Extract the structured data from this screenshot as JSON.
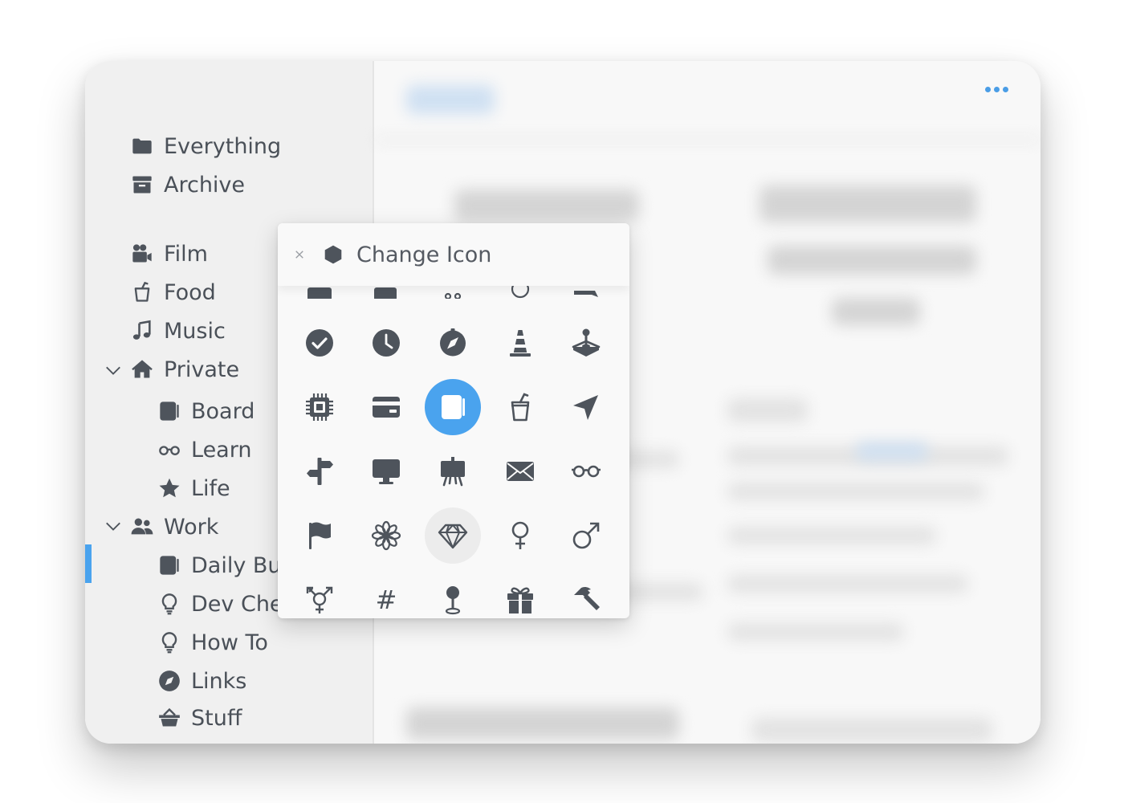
{
  "sidebar": {
    "items": [
      {
        "label": "Everything",
        "icon": "folder-icon"
      },
      {
        "label": "Archive",
        "icon": "archive-icon"
      },
      {
        "label": "Film",
        "icon": "video-camera-icon"
      },
      {
        "label": "Food",
        "icon": "cup-icon"
      },
      {
        "label": "Music",
        "icon": "music-note-icon"
      },
      {
        "label": "Private",
        "icon": "home-icon",
        "expanded": true
      },
      {
        "label": "Board",
        "icon": "notebook-icon"
      },
      {
        "label": "Learn",
        "icon": "glasses-icon"
      },
      {
        "label": "Life",
        "icon": "star-icon"
      },
      {
        "label": "Work",
        "icon": "users-icon",
        "expanded": true
      },
      {
        "label": "Daily Bus",
        "icon": "notebook-icon",
        "active": true
      },
      {
        "label": "Dev Chea",
        "icon": "lightbulb-icon"
      },
      {
        "label": "How To",
        "icon": "lightbulb-icon"
      },
      {
        "label": "Links",
        "icon": "compass-icon"
      },
      {
        "label": "Stuff",
        "icon": "basket-icon"
      }
    ]
  },
  "popover": {
    "title": "Change Icon",
    "icons": {
      "row0": [
        "partial-icon",
        "partial-icon",
        "partial-icon",
        "partial-icon",
        "partial-icon"
      ],
      "row1": [
        "check-circle-icon",
        "clock-icon",
        "compass-icon",
        "traffic-cone-icon",
        "joystick-icon"
      ],
      "row2": [
        "cpu-chip-icon",
        "credit-card-icon",
        "notebook-icon",
        "cup-icon",
        "location-arrow-icon"
      ],
      "row3": [
        "signpost-icon",
        "monitor-icon",
        "easel-icon",
        "envelope-icon",
        "glasses-icon"
      ],
      "row4": [
        "flag-icon",
        "flower-icon",
        "diamond-icon",
        "venus-icon",
        "mars-icon"
      ],
      "row5": [
        "transgender-icon",
        "hashtag-icon",
        "map-pin-icon",
        "gift-icon",
        "hammer-icon"
      ]
    },
    "hash_glyph": "#"
  },
  "colors": {
    "accent": "#4aa3ee",
    "icon": "#4e545c",
    "text": "#4a5058"
  }
}
